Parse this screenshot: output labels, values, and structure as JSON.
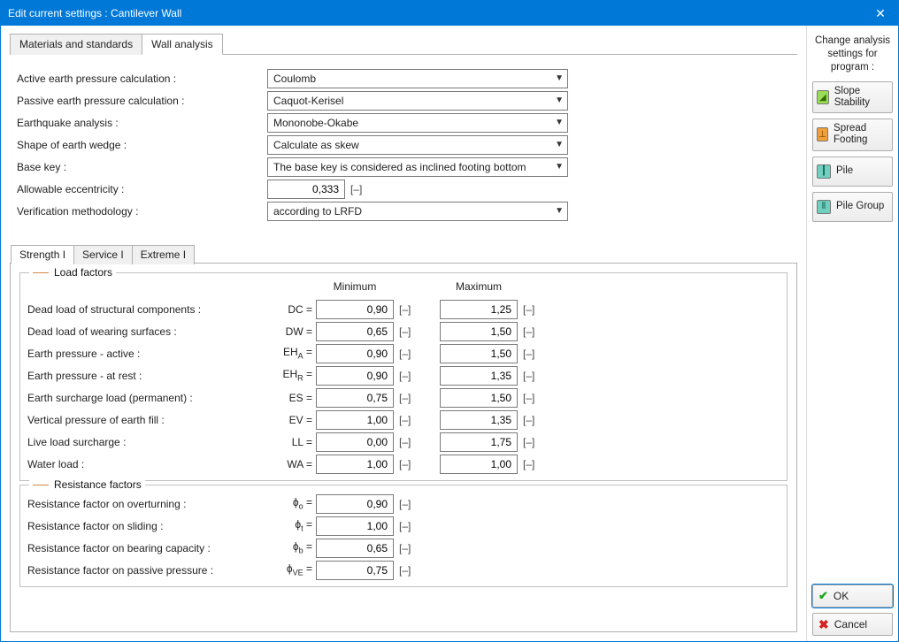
{
  "window": {
    "title": "Edit current settings : Cantilever Wall"
  },
  "tabs": {
    "materials": "Materials and standards",
    "wall": "Wall analysis"
  },
  "form": {
    "active_label": "Active earth pressure calculation :",
    "active_value": "Coulomb",
    "passive_label": "Passive earth pressure calculation :",
    "passive_value": "Caquot-Kerisel",
    "eq_label": "Earthquake analysis :",
    "eq_value": "Mononobe-Okabe",
    "shape_label": "Shape of earth wedge :",
    "shape_value": "Calculate as skew",
    "basekey_label": "Base key :",
    "basekey_value": "The base key is considered as inclined footing bottom",
    "ecc_label": "Allowable eccentricity :",
    "ecc_value": "0,333",
    "ecc_unit": "[–]",
    "verif_label": "Verification methodology :",
    "verif_value": "according to LRFD"
  },
  "subtabs": {
    "s1": "Strength I",
    "s2": "Service I",
    "s3": "Extreme I"
  },
  "load_factors": {
    "legend": "Load factors",
    "h_min": "Minimum",
    "h_max": "Maximum",
    "rows": {
      "dc": {
        "lbl": "Dead load of structural components :",
        "sym": "DC =",
        "min": "0,90",
        "max": "1,25"
      },
      "dw": {
        "lbl": "Dead load of wearing surfaces :",
        "sym": "DW =",
        "min": "0,65",
        "max": "1,50"
      },
      "eha": {
        "lbl": "Earth pressure - active :",
        "sym": "EH",
        "sub": "A",
        "min": "0,90",
        "max": "1,50"
      },
      "ehr": {
        "lbl": "Earth pressure - at rest :",
        "sym": "EH",
        "sub": "R",
        "min": "0,90",
        "max": "1,35"
      },
      "es": {
        "lbl": "Earth surcharge load (permanent) :",
        "sym": "ES =",
        "min": "0,75",
        "max": "1,50"
      },
      "ev": {
        "lbl": "Vertical pressure of earth fill :",
        "sym": "EV =",
        "min": "1,00",
        "max": "1,35"
      },
      "ll": {
        "lbl": "Live load surcharge :",
        "sym": "LL =",
        "min": "0,00",
        "max": "1,75"
      },
      "wa": {
        "lbl": "Water load :",
        "sym": "WA =",
        "min": "1,00",
        "max": "1,00"
      }
    }
  },
  "resist": {
    "legend": "Resistance factors",
    "rows": {
      "o": {
        "lbl": "Resistance factor on overturning :",
        "sub": "o",
        "val": "0,90"
      },
      "t": {
        "lbl": "Resistance factor on sliding :",
        "sub": "t",
        "val": "1,00"
      },
      "b": {
        "lbl": "Resistance factor on bearing capacity :",
        "sub": "b",
        "val": "0,65"
      },
      "ve": {
        "lbl": "Resistance factor on passive pressure :",
        "sub": "VE",
        "val": "0,75"
      }
    }
  },
  "unit": "[–]",
  "sidebar": {
    "heading": "Change analysis settings for program :",
    "slope": "Slope Stability",
    "spread": "Spread Footing",
    "pile": "Pile",
    "pilegroup": "Pile Group",
    "ok": "OK",
    "cancel": "Cancel"
  }
}
